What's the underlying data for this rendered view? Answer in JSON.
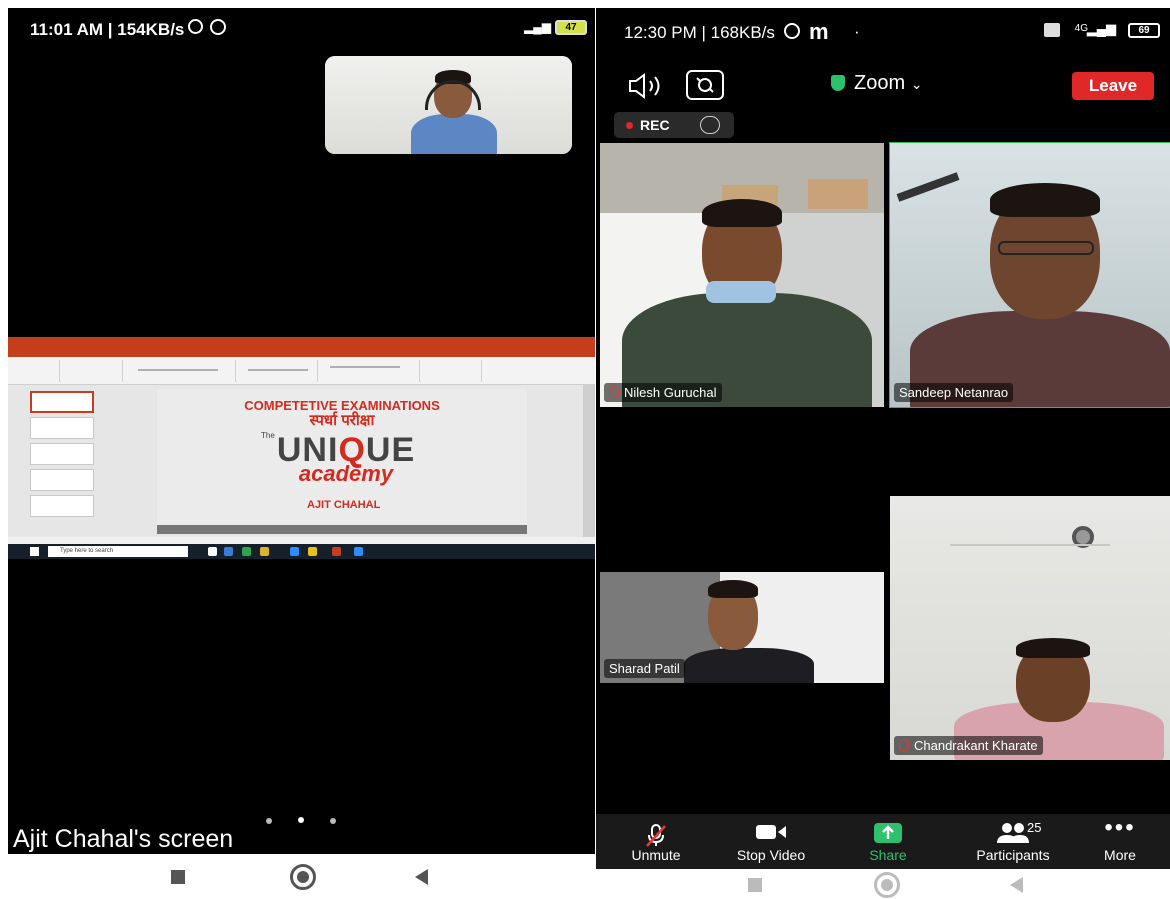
{
  "left_phone": {
    "status": {
      "time_speed": "11:01 AM | 154KB/s",
      "battery": "47"
    },
    "shared_screen_label": "Ajit Chahal's screen",
    "slide": {
      "title_en": "COMPETETIVE EXAMINATIONS",
      "title_hi": "स्पर्धा परीक्षा",
      "logo_main": "UNIQUE",
      "logo_sub": "academy",
      "logo_the": "The",
      "presenter": "AJIT CHAHAL"
    },
    "taskbar_search": "Type here to search"
  },
  "right_phone": {
    "status": {
      "time_speed": "12:30 PM | 168KB/s",
      "network": "4G",
      "battery": "69"
    },
    "top_bar": {
      "title": "Zoom",
      "leave_label": "Leave"
    },
    "rec_label": "REC",
    "participants": [
      {
        "name": "Nilesh Guruchal",
        "muted": true
      },
      {
        "name": "Sandeep Netanrao",
        "muted": false
      },
      {
        "name": "Sharad Patil",
        "muted": false
      },
      {
        "name": "Chandrakant Kharate",
        "muted": true
      }
    ],
    "toolbar": {
      "unmute": "Unmute",
      "stop_video": "Stop Video",
      "share": "Share",
      "participants": "Participants",
      "participants_count": "25",
      "more": "More"
    }
  },
  "colors": {
    "leave": "#e02828",
    "active_speaker": "#35b84f",
    "share_green": "#2ec16d",
    "ppt_red": "#c43e1c"
  }
}
